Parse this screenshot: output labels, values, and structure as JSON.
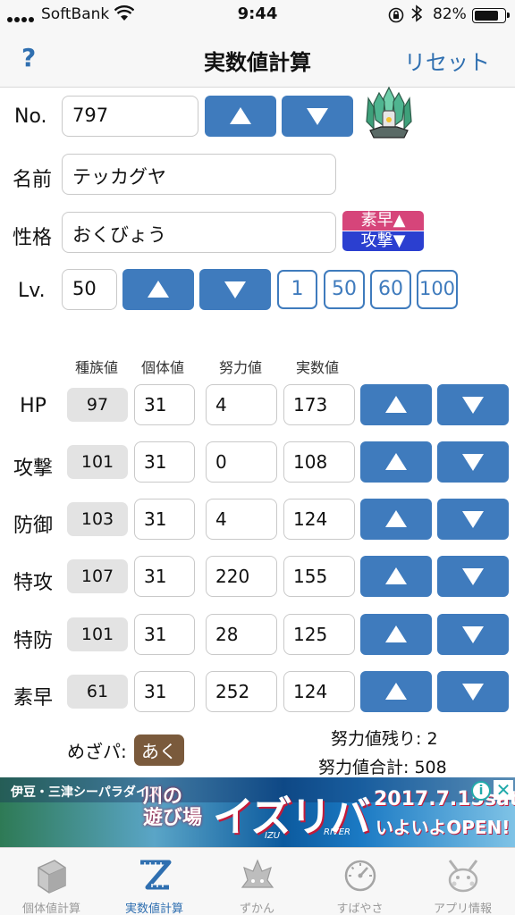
{
  "status": {
    "carrier": "SoftBank",
    "time": "9:44",
    "battery_pct": "82%",
    "battery_level": 0.82
  },
  "nav": {
    "help": "?",
    "title": "実数値計算",
    "reset": "リセット"
  },
  "form": {
    "no_label": "No.",
    "no_value": "797",
    "name_label": "名前",
    "name_value": "テッカグヤ",
    "nature_label": "性格",
    "nature_value": "おくびょう",
    "nature_up": "素早▲",
    "nature_down": "攻撃▼",
    "lv_label": "Lv.",
    "lv_value": "50",
    "lv_presets": [
      "1",
      "50",
      "60",
      "100"
    ]
  },
  "columns": {
    "base": "種族値",
    "iv": "個体値",
    "ev": "努力値",
    "actual": "実数値"
  },
  "stats": [
    {
      "label": "HP",
      "base": "97",
      "iv": "31",
      "ev": "4",
      "actual": "173"
    },
    {
      "label": "攻撃",
      "base": "101",
      "iv": "31",
      "ev": "0",
      "actual": "108"
    },
    {
      "label": "防御",
      "base": "103",
      "iv": "31",
      "ev": "4",
      "actual": "124"
    },
    {
      "label": "特攻",
      "base": "107",
      "iv": "31",
      "ev": "220",
      "actual": "155"
    },
    {
      "label": "特防",
      "base": "101",
      "iv": "31",
      "ev": "28",
      "actual": "125"
    },
    {
      "label": "素早",
      "base": "61",
      "iv": "31",
      "ev": "252",
      "actual": "124"
    }
  ],
  "summary": {
    "hidden_power_label": "めざパ:",
    "hidden_power_type": "あく",
    "ev_remaining": "努力値残り: 2",
    "ev_total": "努力値合計: 508"
  },
  "ad": {
    "brand": "伊豆・三津シーパラダイス",
    "catch": "川の 遊び場",
    "headline": "イズリバ",
    "sub_izu": "IZU",
    "sub_river": "RIVER",
    "date": "2017.7.15sat",
    "open": "いよいよOPEN!",
    "info": "i",
    "close": "✕"
  },
  "tabs": [
    {
      "label": "個体値計算",
      "icon": "cube-icon"
    },
    {
      "label": "実数値計算",
      "icon": "ruler-z-icon"
    },
    {
      "label": "ずかん",
      "icon": "pokedex-icon"
    },
    {
      "label": "すばやさ",
      "icon": "speedometer-icon"
    },
    {
      "label": "アプリ情報",
      "icon": "pikachu-icon"
    }
  ],
  "colors": {
    "accent": "#3f7bbd",
    "link": "#2f6fb0",
    "nature_up": "#d6457a",
    "nature_down": "#2b3fd0",
    "hidden_power_badge": "#7a5a3c"
  }
}
